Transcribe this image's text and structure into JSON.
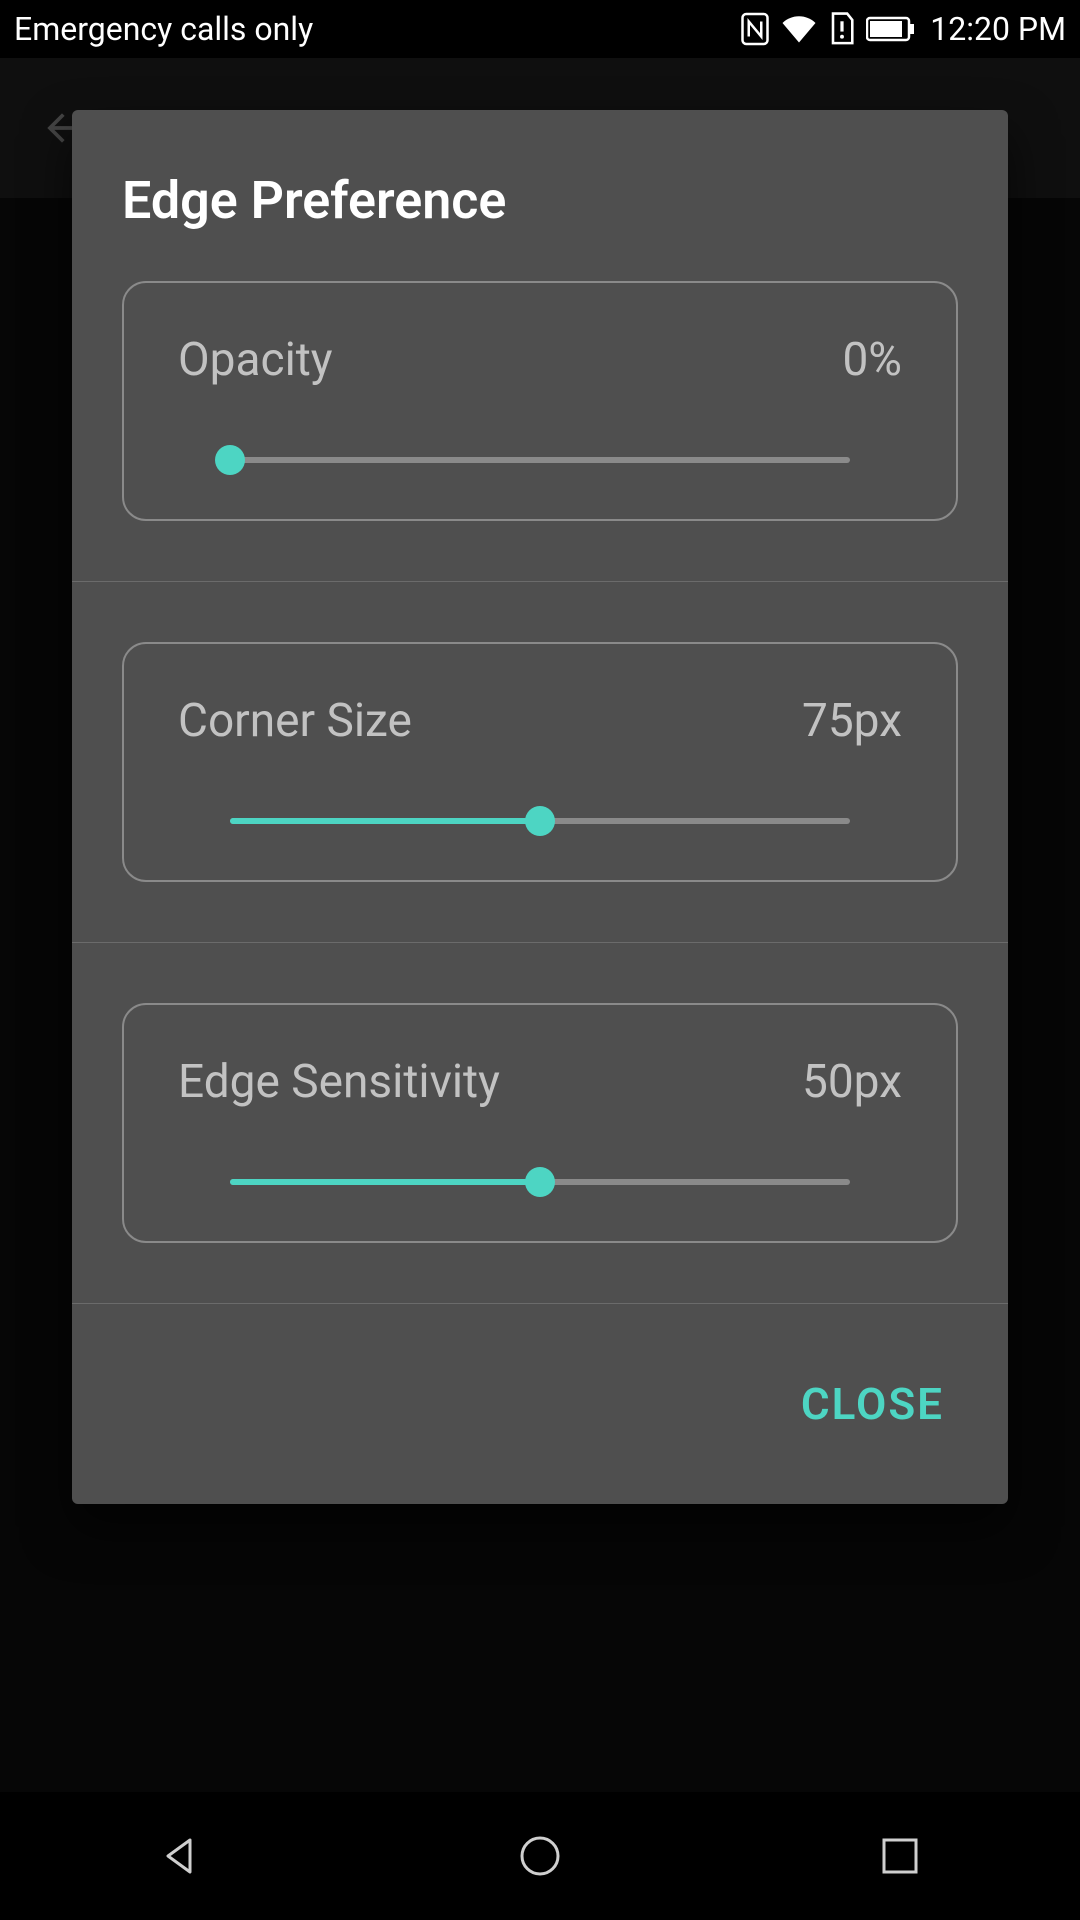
{
  "status": {
    "carrier": "Emergency calls only",
    "time": "12:20 PM"
  },
  "dialog": {
    "title": "Edge Preference",
    "close_label": "CLOSE",
    "settings": [
      {
        "label": "Opacity",
        "value": "0%",
        "percent": 0
      },
      {
        "label": "Corner Size",
        "value": "75px",
        "percent": 50
      },
      {
        "label": "Edge Sensitivity",
        "value": "50px",
        "percent": 50
      }
    ]
  },
  "colors": {
    "accent": "#4dd5c3",
    "dialogBg": "#4f4f4f",
    "textMuted": "#c2c2c2"
  }
}
